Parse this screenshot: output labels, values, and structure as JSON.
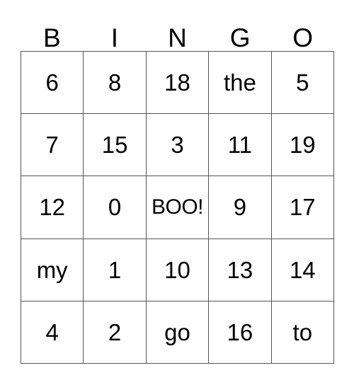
{
  "card": {
    "title": "BINGO",
    "header_letters": [
      "B",
      "I",
      "N",
      "G",
      "O"
    ],
    "free_space_label": "BOO!",
    "colors": {
      "background": "#ffffff",
      "cell_background": "#ffffff",
      "border": "#555555",
      "text": "#000000"
    },
    "grid": {
      "rows": 5,
      "columns": 5,
      "cells": [
        [
          {
            "text": "6",
            "free": false
          },
          {
            "text": "8",
            "free": false
          },
          {
            "text": "18",
            "free": false
          },
          {
            "text": "the",
            "free": false
          },
          {
            "text": "5",
            "free": false
          }
        ],
        [
          {
            "text": "7",
            "free": false
          },
          {
            "text": "15",
            "free": false
          },
          {
            "text": "3",
            "free": false
          },
          {
            "text": "11",
            "free": false
          },
          {
            "text": "19",
            "free": false
          }
        ],
        [
          {
            "text": "12",
            "free": false
          },
          {
            "text": "0",
            "free": false
          },
          {
            "text": "BOO!",
            "free": true
          },
          {
            "text": "9",
            "free": false
          },
          {
            "text": "17",
            "free": false
          }
        ],
        [
          {
            "text": "my",
            "free": false
          },
          {
            "text": "1",
            "free": false
          },
          {
            "text": "10",
            "free": false
          },
          {
            "text": "13",
            "free": false
          },
          {
            "text": "14",
            "free": false
          }
        ],
        [
          {
            "text": "4",
            "free": false
          },
          {
            "text": "2",
            "free": false
          },
          {
            "text": "go",
            "free": false
          },
          {
            "text": "16",
            "free": false
          },
          {
            "text": "to",
            "free": false
          }
        ]
      ]
    }
  }
}
